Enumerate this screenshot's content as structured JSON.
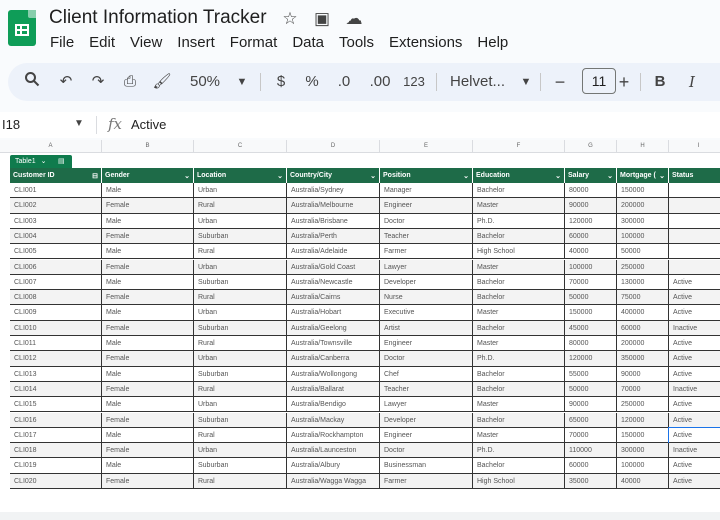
{
  "app": {
    "title": "Client Information Tracker",
    "logo_icon": "sheets-logo-icon"
  },
  "title_icons": [
    "star-icon",
    "move-to-folder-icon",
    "cloud-saved-icon"
  ],
  "menu": [
    "File",
    "Edit",
    "View",
    "Insert",
    "Format",
    "Data",
    "Tools",
    "Extensions",
    "Help"
  ],
  "toolbar": {
    "zoom": "50%",
    "currency": "$",
    "percent": "%",
    "dec_decrease": ".0",
    "dec_increase": ".00",
    "number_format": "123",
    "font": "Helvet...",
    "font_size": "11",
    "bold": "B",
    "italic": "I"
  },
  "formula_bar": {
    "cell_ref": "I18",
    "fx": "fx",
    "value": "Active"
  },
  "col_letters": [
    "A",
    "B",
    "C",
    "D",
    "E",
    "F",
    "G",
    "H",
    "I"
  ],
  "table": {
    "name": "Table1",
    "headers": [
      "Customer ID",
      "Gender",
      "Location",
      "Country/City",
      "Position",
      "Education",
      "Salary",
      "Mortgage (",
      "Status"
    ],
    "rows": [
      [
        "CLI001",
        "Male",
        "Urban",
        "Australia/Sydney",
        "Manager",
        "Bachelor",
        "80000",
        "150000",
        ""
      ],
      [
        "CLI002",
        "Female",
        "Rural",
        "Australia/Melbourne",
        "Engineer",
        "Master",
        "90000",
        "200000",
        ""
      ],
      [
        "CLI003",
        "Male",
        "Urban",
        "Australia/Brisbane",
        "Doctor",
        "Ph.D.",
        "120000",
        "300000",
        ""
      ],
      [
        "CLI004",
        "Female",
        "Suburban",
        "Australia/Perth",
        "Teacher",
        "Bachelor",
        "60000",
        "100000",
        ""
      ],
      [
        "CLI005",
        "Male",
        "Rural",
        "Australia/Adelaide",
        "Farmer",
        "High School",
        "40000",
        "50000",
        ""
      ],
      [
        "CLI006",
        "Female",
        "Urban",
        "Australia/Gold Coast",
        "Lawyer",
        "Master",
        "100000",
        "250000",
        ""
      ],
      [
        "CLI007",
        "Male",
        "Suburban",
        "Australia/Newcastle",
        "Developer",
        "Bachelor",
        "70000",
        "130000",
        "Active"
      ],
      [
        "CLI008",
        "Female",
        "Rural",
        "Australia/Cairns",
        "Nurse",
        "Bachelor",
        "50000",
        "75000",
        "Active"
      ],
      [
        "CLI009",
        "Male",
        "Urban",
        "Australia/Hobart",
        "Executive",
        "Master",
        "150000",
        "400000",
        "Active"
      ],
      [
        "CLI010",
        "Female",
        "Suburban",
        "Australia/Geelong",
        "Artist",
        "Bachelor",
        "45000",
        "60000",
        "Inactive"
      ],
      [
        "CLI011",
        "Male",
        "Rural",
        "Australia/Townsville",
        "Engineer",
        "Master",
        "80000",
        "200000",
        "Active"
      ],
      [
        "CLI012",
        "Female",
        "Urban",
        "Australia/Canberra",
        "Doctor",
        "Ph.D.",
        "120000",
        "350000",
        "Active"
      ],
      [
        "CLI013",
        "Male",
        "Suburban",
        "Australia/Wollongong",
        "Chef",
        "Bachelor",
        "55000",
        "90000",
        "Active"
      ],
      [
        "CLI014",
        "Female",
        "Rural",
        "Australia/Ballarat",
        "Teacher",
        "Bachelor",
        "50000",
        "70000",
        "Inactive"
      ],
      [
        "CLI015",
        "Male",
        "Urban",
        "Australia/Bendigo",
        "Lawyer",
        "Master",
        "90000",
        "250000",
        "Active"
      ],
      [
        "CLI016",
        "Female",
        "Suburban",
        "Australia/Mackay",
        "Developer",
        "Bachelor",
        "65000",
        "120000",
        "Active"
      ],
      [
        "CLI017",
        "Male",
        "Rural",
        "Australia/Rockhampton",
        "Engineer",
        "Master",
        "70000",
        "150000",
        "Active"
      ],
      [
        "CLI018",
        "Female",
        "Urban",
        "Australia/Launceston",
        "Doctor",
        "Ph.D.",
        "110000",
        "300000",
        "Inactive"
      ],
      [
        "CLI019",
        "Male",
        "Suburban",
        "Australia/Albury",
        "Businessman",
        "Bachelor",
        "60000",
        "100000",
        "Active"
      ],
      [
        "CLI020",
        "Female",
        "Rural",
        "Australia/Wagga Wagga",
        "Farmer",
        "High School",
        "35000",
        "40000",
        "Active"
      ]
    ]
  },
  "colors": {
    "header_green": "#1e6b48",
    "tag_green": "#0f7b4d",
    "selection": "#1a73e8"
  }
}
